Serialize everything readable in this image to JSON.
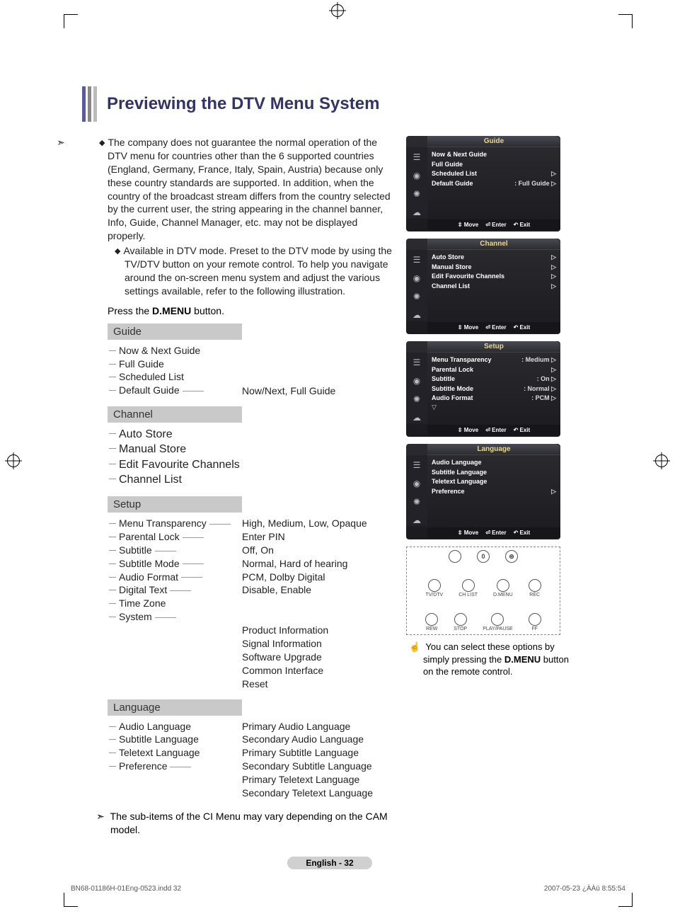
{
  "title": "Previewing the DTV Menu System",
  "intro": {
    "p1": "The company does not guarantee the normal operation of the DTV menu for countries other than the 6 supported countries (England, Germany, France, Italy, Spain, Austria) because only these country standards are supported. In addition, when the country of the broadcast stream differs from the country selected by the current user, the string appearing in the channel banner, Info, Guide, Channel Manager, etc. may not be displayed properly.",
    "p2": "Available in DTV mode. Preset to the DTV mode by using the TV/DTV button on your remote control. To help you navigate around the on-screen menu system and adjust the various settings available, refer to the following illustration."
  },
  "press_line_a": "Press the ",
  "press_line_b": "D.MENU",
  "press_line_c": " button.",
  "sections": {
    "guide": {
      "header": "Guide",
      "items": [
        "Now & Next Guide",
        "Full Guide",
        "Scheduled List",
        "Default Guide"
      ],
      "right": "Now/Next, Full Guide"
    },
    "channel": {
      "header": "Channel",
      "items": [
        "Auto Store",
        "Manual Store",
        "Edit Favourite Channels",
        "Channel List"
      ]
    },
    "setup": {
      "header": "Setup",
      "items": [
        "Menu Transparency",
        "Parental Lock",
        "Subtitle",
        "Subtitle Mode",
        "Audio Format",
        "Digital Text",
        "Time Zone",
        "System"
      ],
      "rights": [
        "High, Medium, Low, Opaque",
        "Enter PIN",
        "Off, On",
        "Normal, Hard of hearing",
        "PCM, Dolby Digital",
        "Disable, Enable",
        "",
        ""
      ],
      "system_sub": [
        "Product Information",
        "Signal Information",
        "Software Upgrade",
        "Common Interface",
        "Reset"
      ]
    },
    "language": {
      "header": "Language",
      "items": [
        "Audio Language",
        "Subtitle Language",
        "Teletext Language",
        "Preference"
      ],
      "pref_sub": [
        "Primary Audio Language",
        "Secondary Audio Language",
        "Primary Subtitle Language",
        "Secondary Subtitle Language",
        "Primary Teletext Language",
        "Secondary Teletext Language"
      ]
    }
  },
  "note_text": "The sub-items of the CI Menu may vary depending on the CAM model.",
  "page_badge": "English - 32",
  "footer_left": "BN68-01186H-01Eng-0523.indd   32",
  "footer_right": "2007-05-23   ¿ÀÀü 8:55:54",
  "osd": {
    "footer": {
      "move": "Move",
      "enter": "Enter",
      "exit": "Exit"
    },
    "guide": {
      "title": "Guide",
      "rows": [
        {
          "label": "Now & Next Guide"
        },
        {
          "label": "Full Guide"
        },
        {
          "label": "Scheduled List",
          "caret": true
        },
        {
          "label": "Default Guide",
          "val": ": Full Guide",
          "caret": true
        }
      ]
    },
    "channel": {
      "title": "Channel",
      "rows": [
        {
          "label": "Auto Store",
          "caret": true
        },
        {
          "label": "Manual Store",
          "caret": true
        },
        {
          "label": "Edit Favourite Channels",
          "caret": true
        },
        {
          "label": "Channel List",
          "caret": true
        }
      ]
    },
    "setup": {
      "title": "Setup",
      "rows": [
        {
          "label": "Menu Transparency",
          "val": ": Medium",
          "caret": true
        },
        {
          "label": "Parental Lock",
          "caret": true
        },
        {
          "label": "Subtitle",
          "val": ": On",
          "caret": true
        },
        {
          "label": "Subtitle  Mode",
          "val": ": Normal",
          "caret": true
        },
        {
          "label": "Audio Format",
          "val": ": PCM",
          "caret": true
        }
      ],
      "more": "▽"
    },
    "language": {
      "title": "Language",
      "rows": [
        {
          "label": "Audio Language"
        },
        {
          "label": "Subtitle Language"
        },
        {
          "label": "Teletext Language"
        },
        {
          "label": "Preference",
          "caret": true
        }
      ]
    }
  },
  "remote": {
    "row1": [
      {
        "glyph": "",
        "label": ""
      },
      {
        "glyph": "0",
        "label": ""
      },
      {
        "glyph": "⊜",
        "label": ""
      }
    ],
    "row2": [
      {
        "glyph": "",
        "label": "TV/DTV"
      },
      {
        "glyph": "",
        "label": "CH LIST"
      },
      {
        "glyph": "",
        "label": "D.MENU"
      },
      {
        "glyph": "",
        "label": "REC"
      }
    ],
    "row3": [
      {
        "glyph": "",
        "label": "REW"
      },
      {
        "glyph": "",
        "label": "STOP"
      },
      {
        "glyph": "",
        "label": "PLAY/PAUSE"
      },
      {
        "glyph": "",
        "label": "FF"
      }
    ]
  },
  "tip_a": "You can select these options by simply pressing the ",
  "tip_b": "D.MENU",
  "tip_c": " button on the remote control."
}
